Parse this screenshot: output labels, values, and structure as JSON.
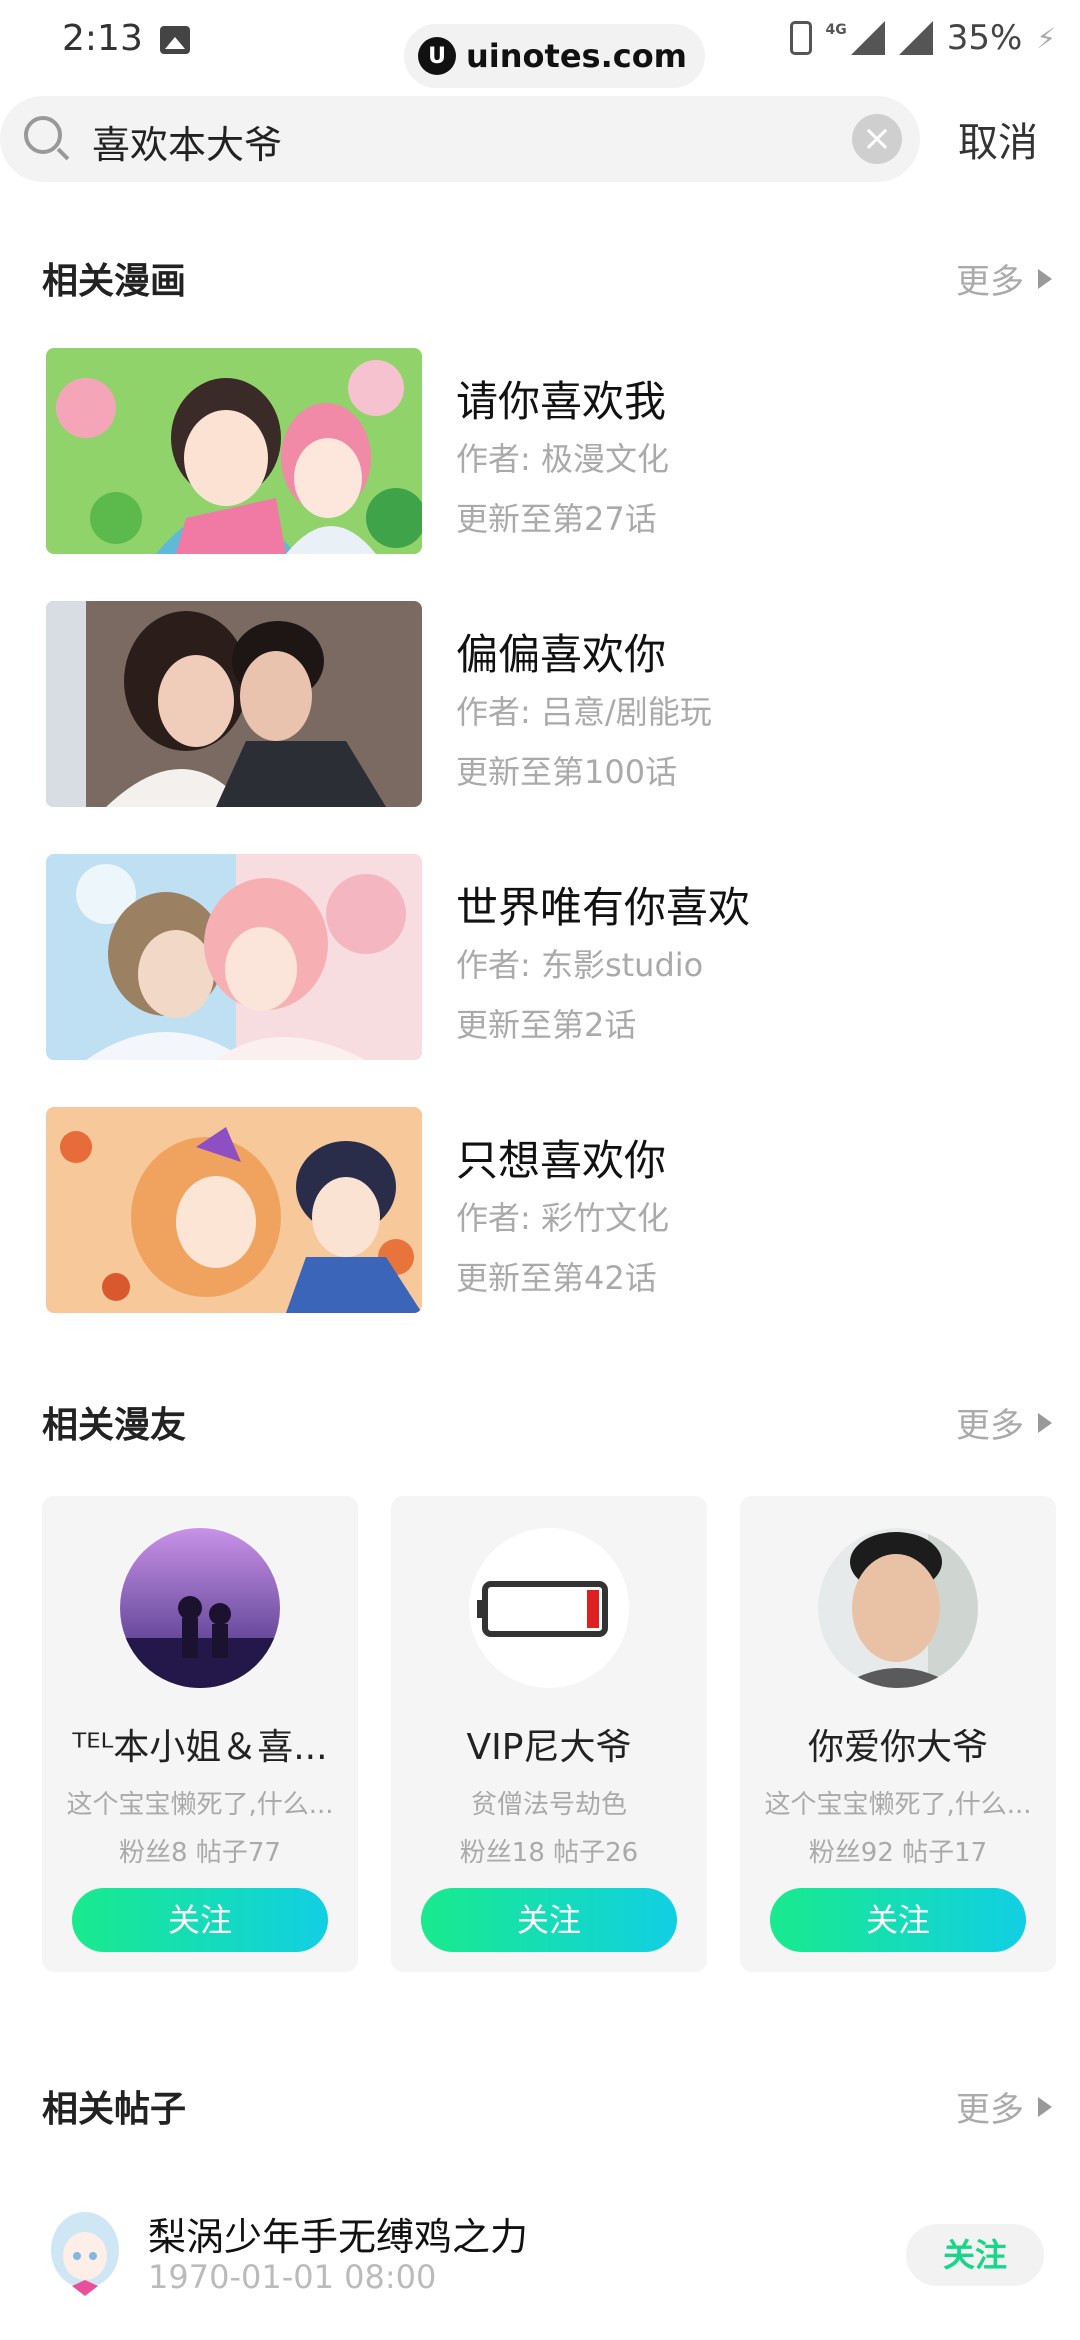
{
  "status_bar": {
    "time": "2:13",
    "watermark": "uinotes.com",
    "network": "4G",
    "battery": "35%"
  },
  "search": {
    "query": "喜欢本大爷",
    "cancel_label": "取消"
  },
  "sections": {
    "comics": {
      "title": "相关漫画",
      "more": "更多"
    },
    "users": {
      "title": "相关漫友",
      "more": "更多"
    },
    "posts": {
      "title": "相关帖子",
      "more": "更多"
    }
  },
  "comics": [
    {
      "title": "请你喜欢我",
      "author": "作者: 极漫文化",
      "update": "更新至第27话"
    },
    {
      "title": "偏偏喜欢你",
      "author": "作者: 吕意/剧能玩",
      "update": "更新至第100话"
    },
    {
      "title": "世界唯有你喜欢",
      "author": "作者: 东影studio",
      "update": "更新至第2话"
    },
    {
      "title": "只想喜欢你",
      "author": "作者: 彩竹文化",
      "update": "更新至第42话"
    }
  ],
  "users": [
    {
      "name": "ᵀᴱᴸ本小姐＆喜...",
      "bio": "这个宝宝懒死了,什么...",
      "stats": "粉丝8 帖子77",
      "follow": "关注"
    },
    {
      "name": "VIP尼大爷",
      "bio": "贫僧法号劫色",
      "stats": "粉丝18 帖子26",
      "follow": "关注"
    },
    {
      "name": "你爱你大爷",
      "bio": "这个宝宝懒死了,什么...",
      "stats": "粉丝92 帖子17",
      "follow": "关注"
    }
  ],
  "post": {
    "name": "梨涡少年手无缚鸡之力",
    "date": "1970-01-01 08:00",
    "follow": "关注"
  },
  "colors": {
    "accent_green": "#17d68a",
    "gradient_start": "#19ea8c",
    "gradient_end": "#11cfe4"
  }
}
